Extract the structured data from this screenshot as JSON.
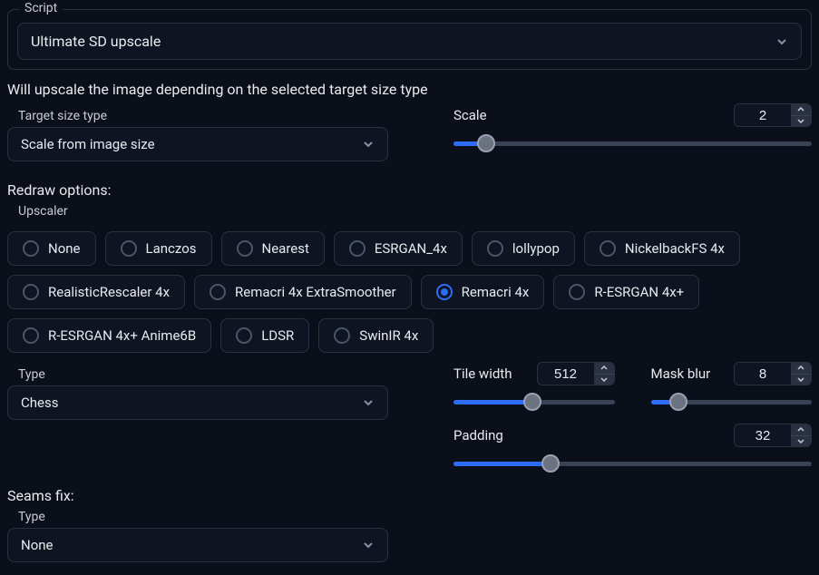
{
  "script": {
    "label": "Script",
    "value": "Ultimate SD upscale"
  },
  "info_text": "Will upscale the image depending on the selected target size type",
  "target_size": {
    "label": "Target size type",
    "value": "Scale from image size"
  },
  "scale": {
    "label": "Scale",
    "value": "2",
    "fill_pct": 9
  },
  "redraw_title": "Redraw options:",
  "upscaler": {
    "label": "Upscaler",
    "options": [
      {
        "key": "none",
        "label": "None"
      },
      {
        "key": "lanczos",
        "label": "Lanczos"
      },
      {
        "key": "nearest",
        "label": "Nearest"
      },
      {
        "key": "esrgan4x",
        "label": "ESRGAN_4x"
      },
      {
        "key": "lollypop",
        "label": "lollypop"
      },
      {
        "key": "nickelbackfs4x",
        "label": "NickelbackFS 4x"
      },
      {
        "key": "realisticrescaler4x",
        "label": "RealisticRescaler 4x"
      },
      {
        "key": "remacri4xextra",
        "label": "Remacri 4x ExtraSmoother"
      },
      {
        "key": "remacri4x",
        "label": "Remacri 4x"
      },
      {
        "key": "resrgan4xplus",
        "label": "R-ESRGAN 4x+"
      },
      {
        "key": "resrgan4xanime",
        "label": "R-ESRGAN 4x+ Anime6B"
      },
      {
        "key": "ldsr",
        "label": "LDSR"
      },
      {
        "key": "swinir4x",
        "label": "SwinIR 4x"
      }
    ],
    "selected": "remacri4x"
  },
  "type_redraw": {
    "label": "Type",
    "value": "Chess"
  },
  "tile_width": {
    "label": "Tile width",
    "value": "512",
    "fill_pct": 49
  },
  "mask_blur": {
    "label": "Mask blur",
    "value": "8",
    "fill_pct": 17
  },
  "padding": {
    "label": "Padding",
    "value": "32",
    "fill_pct": 27
  },
  "seams_title": "Seams fix:",
  "seams_type": {
    "label": "Type",
    "value": "None"
  }
}
